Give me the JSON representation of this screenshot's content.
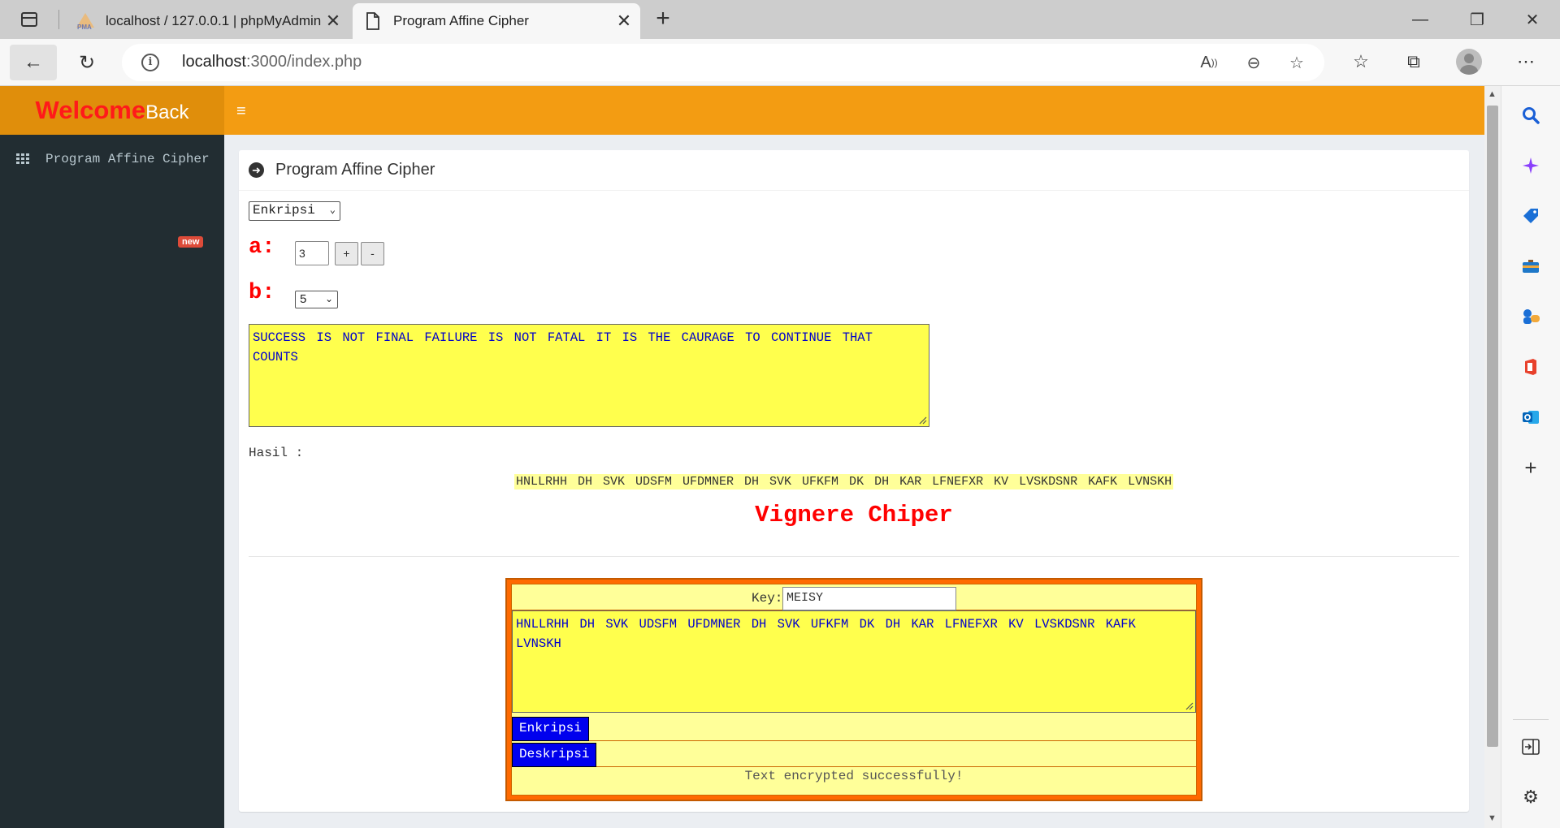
{
  "browser": {
    "tabs": [
      {
        "title": "localhost / 127.0.0.1 | phpMyAdmin",
        "favicon": "phpmyadmin-icon",
        "favicon_text": "PMA"
      },
      {
        "title": "Program Affine Cipher",
        "favicon": "page-icon"
      }
    ],
    "url_host": "localhost",
    "url_path": ":3000/index.php",
    "icons": {
      "back": "←",
      "reload": "↻",
      "read_aloud": "A",
      "zoom_out": "⊖",
      "favorite_add": "☆",
      "favorites": "☆",
      "collections": "⧉",
      "more": "⋯",
      "minimize": "—",
      "restore": "❐",
      "close": "✕",
      "new_tab": "+",
      "tab_close": "✕"
    }
  },
  "app": {
    "brand_main": "Welcome",
    "brand_sub": "Back",
    "hamburger": "≡",
    "sidebar": {
      "item_label": "Program Affine Ciphe",
      "item_tail": "r",
      "badge": "new"
    },
    "box_title": "Program Affine Cipher",
    "mode_value": "Enkripsi",
    "a_label": "a:",
    "a_value": "3",
    "dash": "-",
    "plus_label": "+",
    "minus_label": "-",
    "b_label": "b:",
    "b_value": "5",
    "plaintext": "SUCCESS IS NOT FINAL FAILURE IS NOT FATAL IT IS THE CAURAGE TO CONTINUE THAT COUNTS",
    "hasil_label": "Hasil :",
    "hasil_text": "HNLLRHH DH SVK UDSFM UFDMNER DH SVK UFKFM DK DH KAR LFNEFXR KV LVSKDSNR KAFK LVNSKH",
    "vig_title": "Vignere Chiper",
    "key_label": "Key:",
    "key_value": "MEISY",
    "vig_text": "HNLLRHH DH SVK UDSFM UFDMNER DH SVK UFKFM DK DH KAR LFNEFXR KV LVSKDSNR KAFK LVNSKH",
    "btn_enkripsi": "Enkripsi",
    "btn_deskripsi": "Deskripsi",
    "status": "Text encrypted successfully!"
  },
  "colors": {
    "topbar": "#f39c12",
    "brand_bg": "#e08e0b",
    "sidebar": "#222d32",
    "welcome": "#ff1a1a",
    "textarea": "#ffff4d",
    "cipher_text": "#0000cc",
    "panel_border": "#ff6a00",
    "button": "#0000ee"
  }
}
